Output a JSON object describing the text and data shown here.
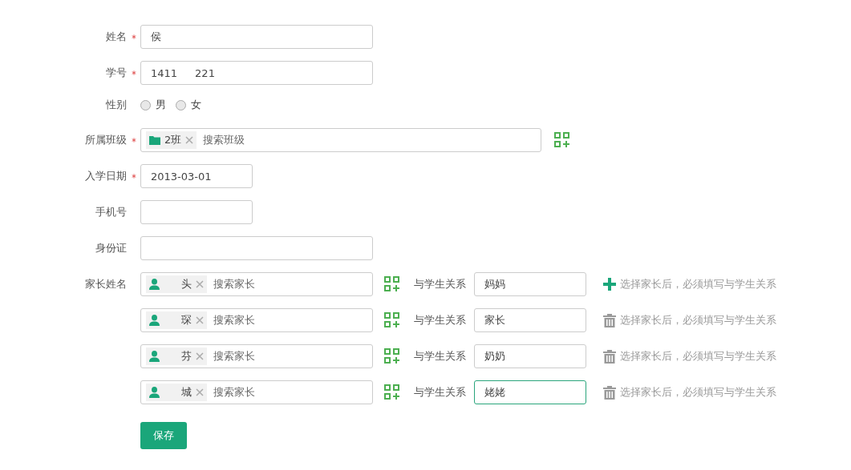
{
  "fields": [
    {
      "kind": "text",
      "label": "姓名",
      "required": true,
      "value": "侯"
    },
    {
      "kind": "text",
      "label": "学号",
      "required": true,
      "value": "1411",
      "value_after": "221"
    },
    {
      "kind": "radio",
      "label": "性别",
      "required": false,
      "options": [
        {
          "label": "男",
          "selected": false
        },
        {
          "label": "女",
          "selected": false
        }
      ]
    },
    {
      "kind": "tags",
      "label": "所属班级",
      "required": true,
      "tag": "2班",
      "placeholder": "搜索班级"
    },
    {
      "kind": "date",
      "label": "入学日期",
      "required": true,
      "value": "2013-03-01"
    },
    {
      "kind": "phone",
      "label": "手机号",
      "required": false
    },
    {
      "kind": "text",
      "label": "身份证",
      "required": false
    }
  ],
  "parents": {
    "label": "家长姓名",
    "rows": [
      {
        "name": "头",
        "placeholder": "搜索家长",
        "relation_label": "与学生关系",
        "relation": "妈妈",
        "kind": "add",
        "hint": "选择家长后，必须填写与学生关系",
        "focused": false
      },
      {
        "name": "琛",
        "placeholder": "搜索家长",
        "relation_label": "与学生关系",
        "relation": "家长",
        "kind": "delete",
        "hint": "选择家长后，必须填写与学生关系",
        "focused": false
      },
      {
        "name": "芬",
        "placeholder": "搜索家长",
        "relation_label": "与学生关系",
        "relation": "奶奶",
        "kind": "delete",
        "hint": "选择家长后，必须填写与学生关系",
        "focused": false
      },
      {
        "name": "城",
        "placeholder": "搜索家长",
        "relation_label": "与学生关系",
        "relation": "姥姥",
        "kind": "delete",
        "hint": "选择家长后，必须填写与学生关系",
        "focused": true
      }
    ]
  },
  "save_button": "保存"
}
